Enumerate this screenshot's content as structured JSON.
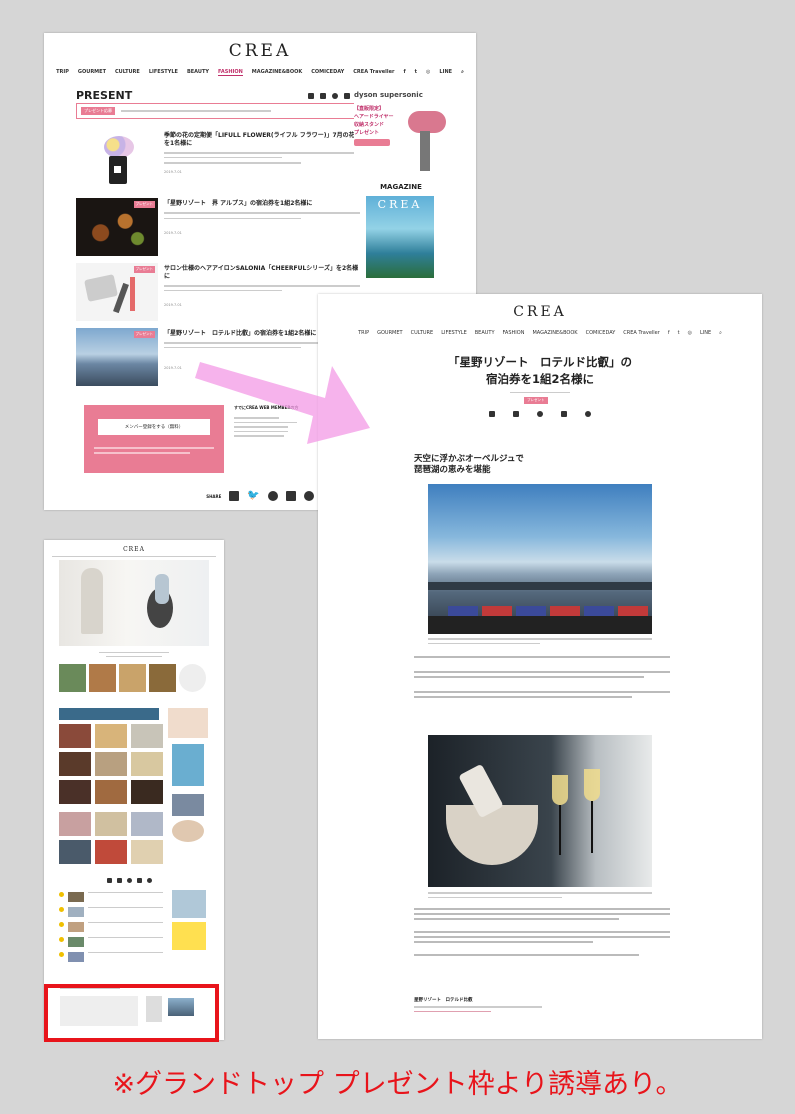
{
  "site_logo": "CREA",
  "present_page": {
    "nav": [
      "TRIP",
      "GOURMET",
      "CULTURE",
      "LIFESTYLE",
      "BEAUTY",
      "FASHION",
      "MAGAZINE&BOOK",
      "COMICEDAY",
      "CREA Traveller",
      "LINE"
    ],
    "active_nav": "FASHION",
    "heading": "PRESENT",
    "notice_badge": "プレゼント応募",
    "items": [
      {
        "title": "季節の花の定期便「LIFULL FLOWER(ライフル フラワー)」7月の花を1名様に",
        "date": "2019.7.01",
        "badge": ""
      },
      {
        "title": "「星野リゾート　界 アルプス」の宿泊券を1組2名様に",
        "date": "2019.7.01",
        "badge": "プレゼント"
      },
      {
        "title": "サロン仕様のヘアアイロンSALONIA「CHEERFULシリーズ」を2名様に",
        "date": "2019.7.01",
        "badge": "プレゼント"
      },
      {
        "title": "「星野リゾート　ロテルド比叡」の宿泊券を1組2名様に",
        "date": "2019.7.01",
        "badge": "プレゼント"
      }
    ],
    "ad_brand": "dyson supersonic",
    "ad_text_lines": [
      "【直販限定】",
      "ヘアードライヤー",
      "収納スタンド",
      "プレゼント"
    ],
    "magazine_heading": "MAGAZINE",
    "magazine_logo": "CREA",
    "member_button": "メンバー登録をする（無料）",
    "member_side_heading": "すでにCREA WEB MEMBERの方",
    "share_label": "SHARE"
  },
  "article_page": {
    "nav": [
      "TRIP",
      "GOURMET",
      "CULTURE",
      "LIFESTYLE",
      "BEAUTY",
      "FASHION",
      "MAGAZINE&BOOK",
      "COMICEDAY",
      "CREA Traveller",
      "LINE"
    ],
    "title_line1": "「星野リゾート　ロテルド比叡」の",
    "title_line2": "宿泊券を1組2名様に",
    "badge": "プレゼント",
    "section_heading_line1": "天空に浮かぶオーベルジュで",
    "section_heading_line2": "琵琶湖の恵みを堪能",
    "footer_heading": "星野リゾート　ロテルド比叡"
  },
  "caption": "※グランドトップ プレゼント枠より誘導あり。",
  "colors": {
    "accent_pink": "#e97c94",
    "highlight_red": "#e8141b",
    "arrow_pink": "#f39ae6"
  }
}
